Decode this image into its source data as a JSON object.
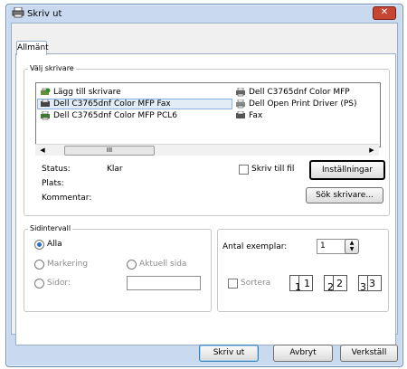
{
  "window": {
    "title": "Skriv ut",
    "close_glyph": "✕"
  },
  "tabs": [
    {
      "label": "Allmänt"
    }
  ],
  "select_printer": {
    "legend": "Välj skrivare",
    "items": [
      {
        "label": "Lägg till skrivare",
        "icon": "add-printer-icon"
      },
      {
        "label": "Dell C3765dnf Color MFP",
        "icon": "printer-icon"
      },
      {
        "label": "Dell C3765dnf Color MFP Fax",
        "icon": "fax-icon",
        "selected": true
      },
      {
        "label": "Dell Open Print Driver (PS)",
        "icon": "printer-icon"
      },
      {
        "label": "Dell C3765dnf Color MFP PCL6",
        "icon": "printer-icon"
      },
      {
        "label": "Fax",
        "icon": "fax-icon"
      }
    ],
    "scroll": {
      "left": "◀",
      "thumb": "III",
      "right": "▶"
    }
  },
  "status": {
    "status_label": "Status:",
    "status_value": "Klar",
    "location_label": "Plats:",
    "comment_label": "Kommentar:",
    "print_to_file": "Skriv till fil",
    "settings_button": "Inställningar",
    "find_printer_button": "Sök skrivare..."
  },
  "page_range": {
    "legend": "Sidintervall",
    "all": "Alla",
    "selection": "Markering",
    "current": "Aktuell sida",
    "pages": "Sidor:"
  },
  "copies": {
    "label": "Antal exemplar:",
    "value": "1",
    "collate": "Sortera",
    "numbers": [
      "1",
      "1",
      "2",
      "2",
      "3",
      "3"
    ]
  },
  "footer": {
    "print": "Skriv ut",
    "cancel": "Avbryt",
    "apply": "Verkställ"
  }
}
